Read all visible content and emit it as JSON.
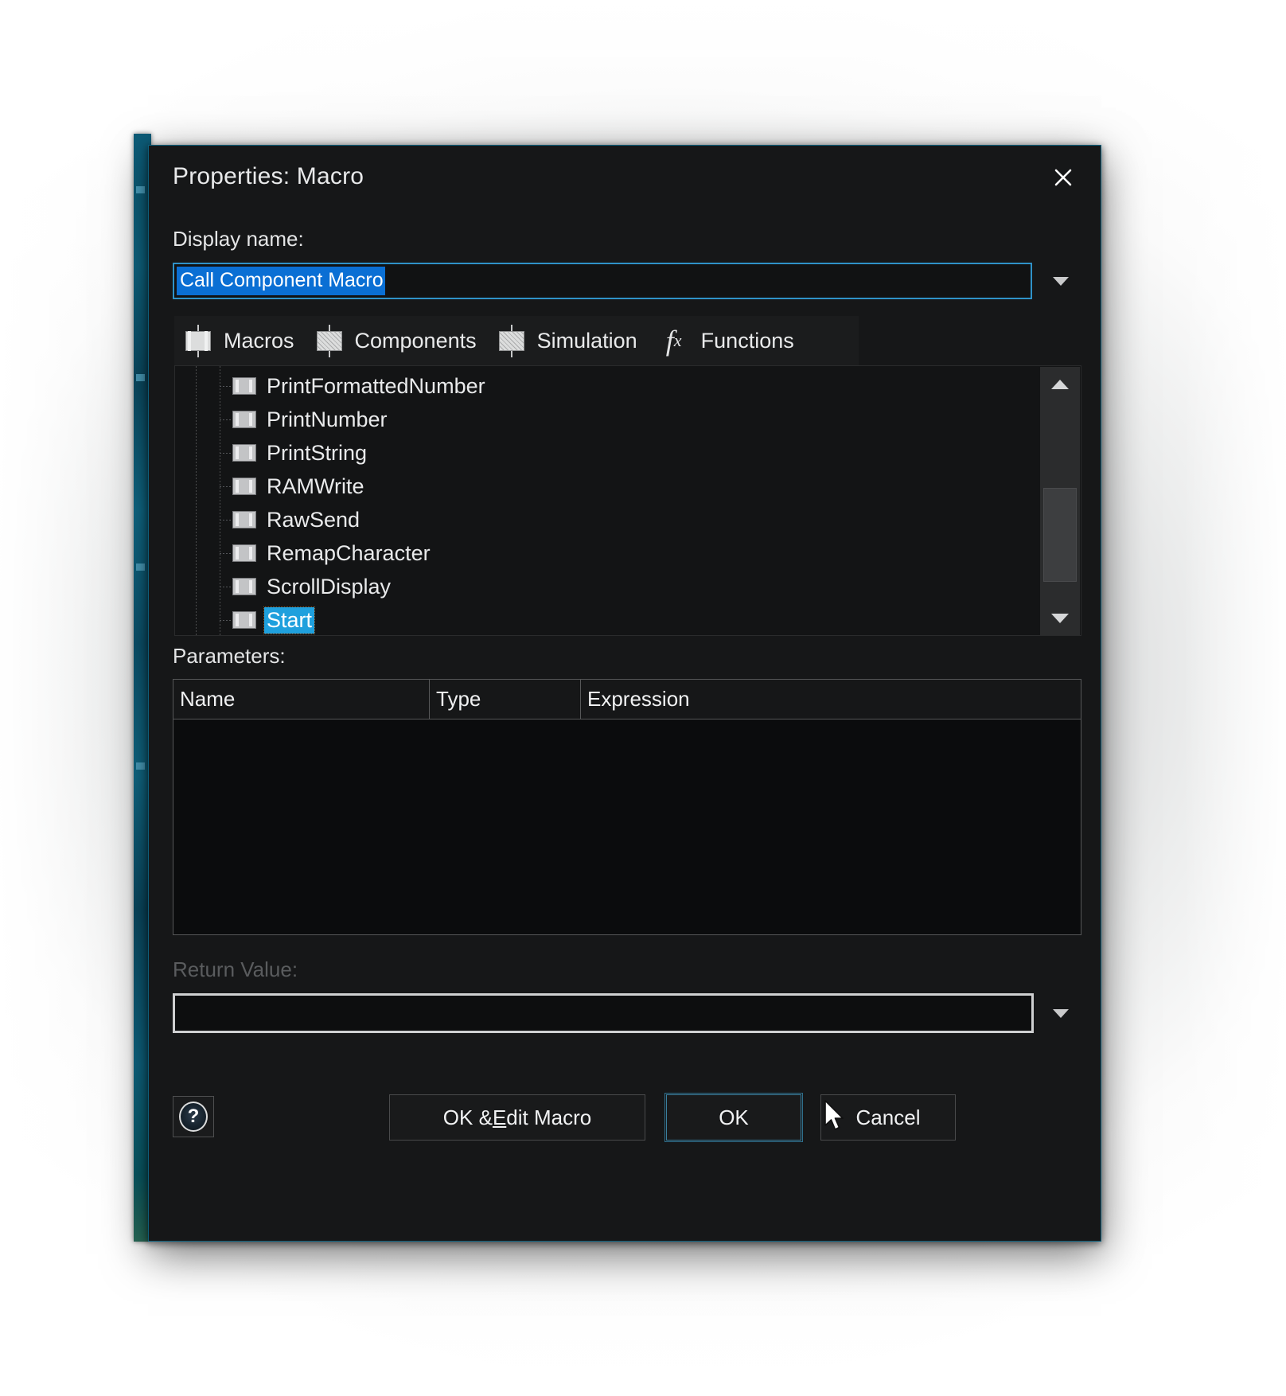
{
  "dialog": {
    "title": "Properties: Macro",
    "close_icon": "close-icon"
  },
  "display_name": {
    "label": "Display name:",
    "value": "Call Component Macro",
    "dropdown_icon": "chevron-down-icon"
  },
  "tabs": [
    {
      "label": "Macros",
      "icon": "chip-icon",
      "selected": true
    },
    {
      "label": "Components",
      "icon": "chip-hatched-icon",
      "selected": false
    },
    {
      "label": "Simulation",
      "icon": "chip-hatched-icon",
      "selected": false
    },
    {
      "label": "Functions",
      "icon": "fx-icon",
      "selected": false
    }
  ],
  "tree": {
    "items": [
      {
        "label": "PrintFormattedNumber",
        "selected": false
      },
      {
        "label": "PrintNumber",
        "selected": false
      },
      {
        "label": "PrintString",
        "selected": false
      },
      {
        "label": "RAMWrite",
        "selected": false
      },
      {
        "label": "RawSend",
        "selected": false
      },
      {
        "label": "RemapCharacter",
        "selected": false
      },
      {
        "label": "ScrollDisplay",
        "selected": false
      },
      {
        "label": "Start",
        "selected": true
      }
    ],
    "scroll_up_icon": "triangle-up-icon",
    "scroll_down_icon": "triangle-down-icon"
  },
  "parameters": {
    "label": "Parameters:",
    "columns": [
      "Name",
      "Type",
      "Expression"
    ],
    "rows": []
  },
  "return_value": {
    "label": "Return Value:",
    "value": "",
    "dropdown_icon": "chevron-down-icon",
    "disabled": true
  },
  "footer": {
    "help_label": "?",
    "edit_macro_label_pre": "OK & ",
    "edit_macro_accel": "E",
    "edit_macro_label_post": "dit Macro",
    "ok_label": "OK",
    "cancel_label": "Cancel"
  },
  "colors": {
    "accent_selection": "#0a6fd4",
    "accent_tree_selection": "#1fa0dd",
    "focus_border": "#2f92c8",
    "dialog_bg": "#161718",
    "app_behind_teal": "#0f6a88"
  }
}
